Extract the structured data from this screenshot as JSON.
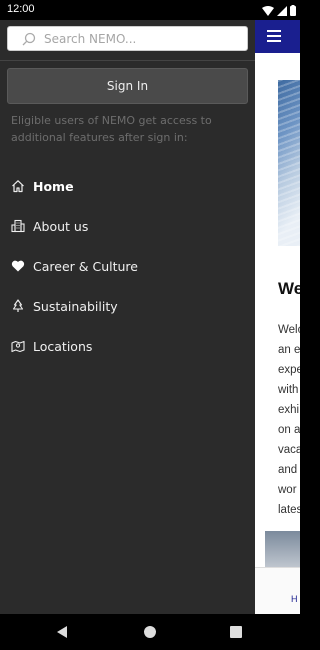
{
  "status_bar": {
    "time": "12:00"
  },
  "search": {
    "placeholder": "Search NEMO..."
  },
  "signin": {
    "button_label": "Sign In",
    "note": "Eligible users of NEMO get access to additional features after sign in:"
  },
  "nav": {
    "items": [
      {
        "label": "Home",
        "icon": "home-icon",
        "active": true
      },
      {
        "label": "About us",
        "icon": "building-icon",
        "active": false
      },
      {
        "label": "Career & Culture",
        "icon": "heart-icon",
        "active": false
      },
      {
        "label": "Sustainability",
        "icon": "tree-icon",
        "active": false
      },
      {
        "label": "Locations",
        "icon": "map-pin-icon",
        "active": false
      }
    ]
  },
  "background_page": {
    "heading": "We",
    "paragraph_lines": [
      "Welc",
      "an e",
      "expe",
      "with",
      "exhi",
      "on a",
      "vaca",
      "and",
      "wor",
      "lates"
    ],
    "bottom_tab_label": "H"
  },
  "colors": {
    "drawer_bg": "#2b2b2b",
    "header_blue": "#1a1f8f",
    "signin_bg": "#4a4a4a"
  }
}
